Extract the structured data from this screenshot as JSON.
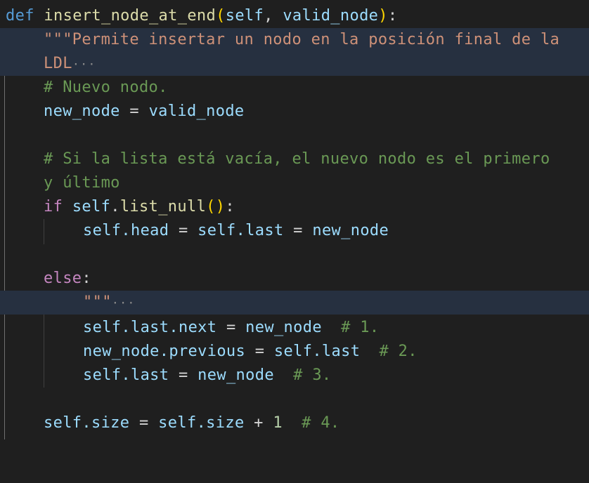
{
  "editor": {
    "language": "python",
    "lines": {
      "l1": {
        "kw": "def",
        "fn": "insert_node_at_end",
        "paren_open": "(",
        "self": "self",
        "comma": ", ",
        "param": "valid_node",
        "paren_close": ")",
        "colon": ":"
      },
      "l2": {
        "docstring": "\"\"\"Permite insertar un nodo en la posición final de la"
      },
      "l3": {
        "docstring": "LDL",
        "fold": "···"
      },
      "l4": {
        "comment": "# Nuevo nodo."
      },
      "l5": {
        "var": "new_node",
        "op": " = ",
        "val": "valid_node"
      },
      "l7": {
        "comment": "# Si la lista está vacía, el nuevo nodo es el primero"
      },
      "l8": {
        "comment": "y último"
      },
      "l9": {
        "kw": "if",
        "obj": "self",
        "dot": ".",
        "method": "list_null",
        "parens": "()",
        "colon": ":"
      },
      "l10": {
        "a": "self",
        "b": ".head",
        "eq1": " = ",
        "c": "self",
        "d": ".last",
        "eq2": " = ",
        "e": "new_node"
      },
      "l12": {
        "kw": "else",
        "colon": ":"
      },
      "l13": {
        "docstring": "\"\"\"",
        "fold": "···"
      },
      "l14": {
        "a": "self",
        "b": ".last",
        "c": ".next",
        "eq": " = ",
        "d": "new_node",
        "comment": "  # 1."
      },
      "l15": {
        "a": "new_node",
        "b": ".previous",
        "eq": " = ",
        "c": "self",
        "d": ".last",
        "comment": "  # 2."
      },
      "l16": {
        "a": "self",
        "b": ".last",
        "eq": " = ",
        "c": "new_node",
        "comment": "  # 3."
      },
      "l18": {
        "a": "self",
        "b": ".size",
        "eq": " = ",
        "c": "self",
        "d": ".size",
        "plus": " + ",
        "num": "1",
        "comment": "  # 4."
      }
    }
  },
  "colors": {
    "background": "#1f1f1f",
    "keyword": "#569cd6",
    "control": "#c586c0",
    "function": "#dcdcaa",
    "variable": "#9cdcfe",
    "string": "#ce9178",
    "comment": "#6a9955",
    "number": "#b5cea8",
    "bracket": "#ffd700",
    "highlight": "#263040"
  }
}
